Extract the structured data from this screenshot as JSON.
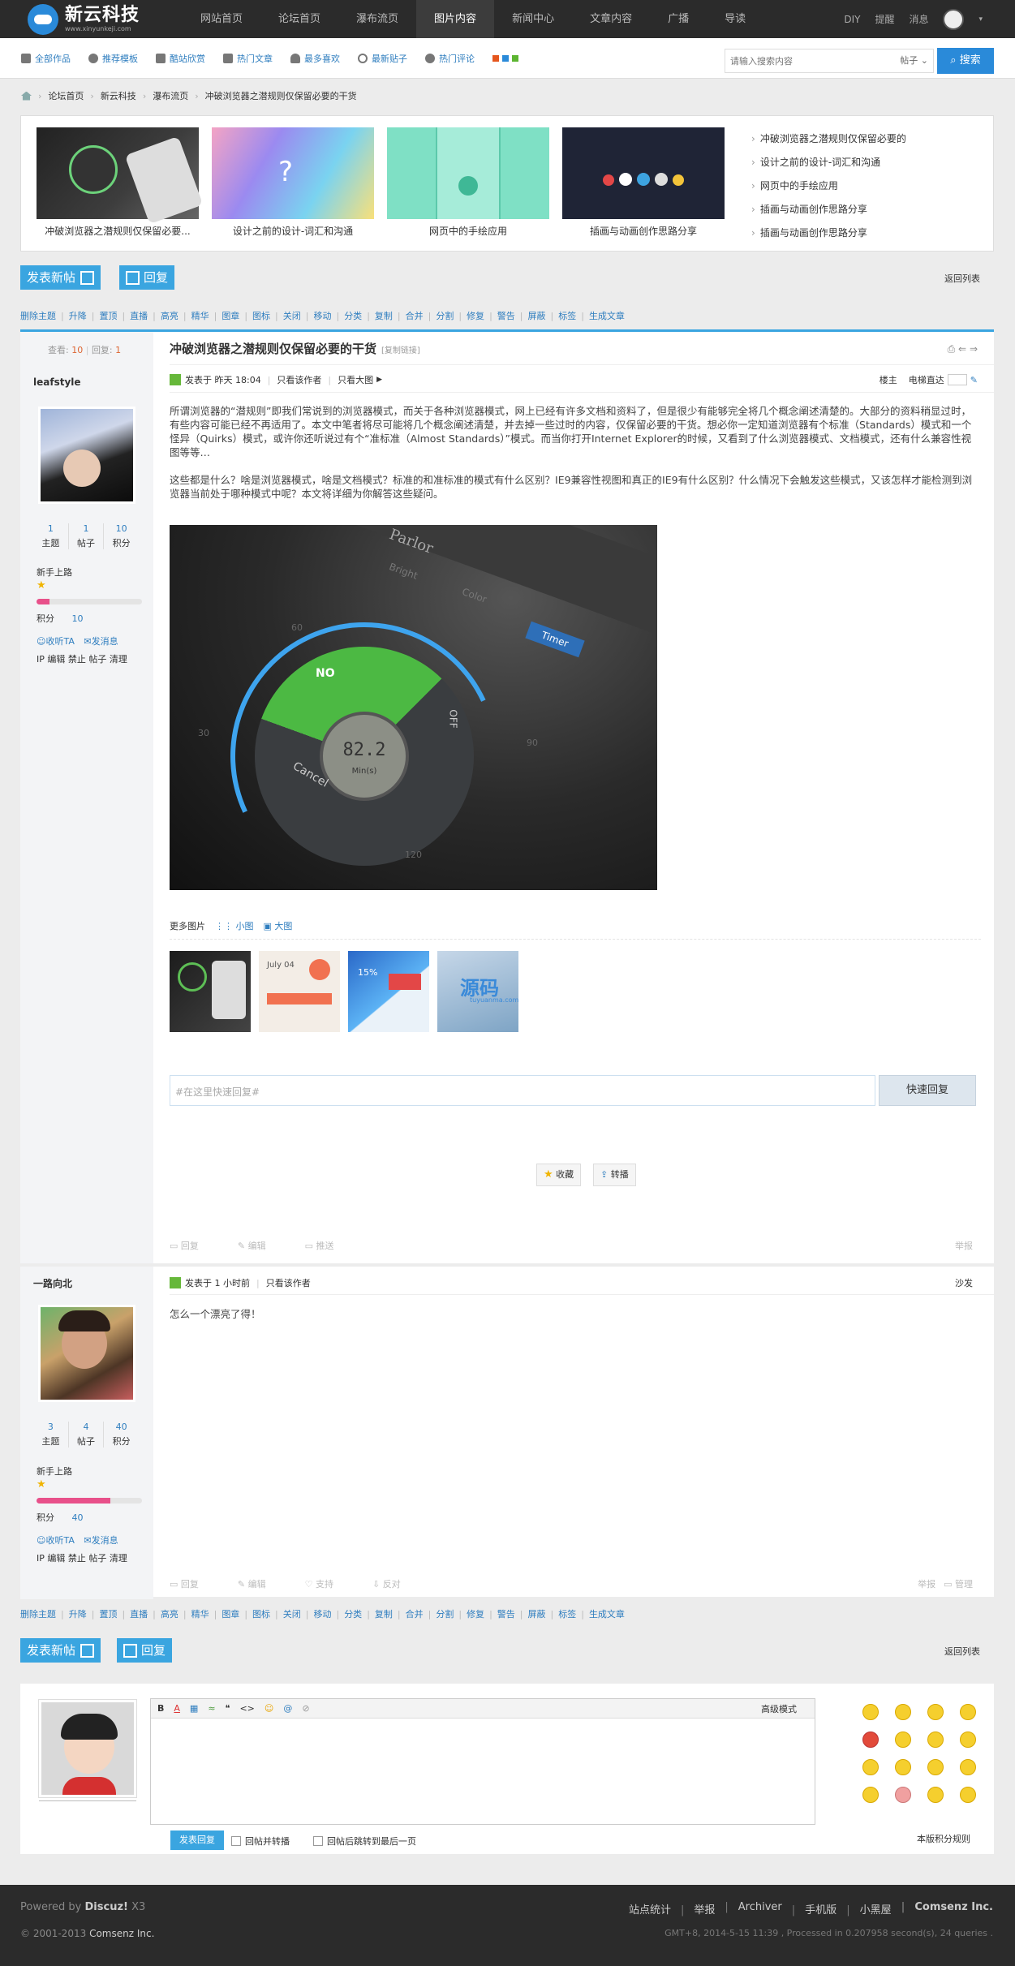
{
  "site": {
    "name": "新云科技",
    "domain": "www.xinyunkeji.com"
  },
  "nav": {
    "items": [
      "网站首页",
      "论坛首页",
      "瀑布流页",
      "图片内容",
      "新闻中心",
      "文章内容",
      "广播",
      "导读"
    ],
    "current": 3
  },
  "topright": {
    "items": [
      "DIY",
      "提醒",
      "消息"
    ]
  },
  "subbar": {
    "items": [
      "全部作品",
      "推荐模板",
      "酷站欣赏",
      "热门文章",
      "最多喜欢",
      "最新贴子",
      "热门评论"
    ],
    "colors": [
      "#e5561e",
      "#2a8ad9",
      "#5cb531"
    ]
  },
  "search": {
    "placeholder": "请输入搜索内容",
    "scope": "帖子",
    "button": "搜索"
  },
  "breadcrumb": [
    "论坛首页",
    "新云科技",
    "瀑布流页",
    "冲破浏览器之潜规则仅保留必要的干货"
  ],
  "slider": {
    "captions": [
      "冲破浏览器之潜规则仅保留必要...",
      "设计之前的设计-词汇和沟通",
      "网页中的手绘应用",
      "插画与动画创作思路分享"
    ],
    "hot": [
      "冲破浏览器之潜规则仅保留必要的",
      "设计之前的设计-词汇和沟通",
      "网页中的手绘应用",
      "插画与动画创作思路分享",
      "插画与动画创作思路分享"
    ]
  },
  "actions": {
    "newpost": "发表新帖",
    "reply": "回复",
    "backlist": "返回列表"
  },
  "modbar": [
    "删除主题",
    "升降",
    "置顶",
    "直播",
    "高亮",
    "精华",
    "图章",
    "图标",
    "关闭",
    "移动",
    "分类",
    "复制",
    "合并",
    "分割",
    "修复",
    "警告",
    "屏蔽",
    "标签",
    "生成文章"
  ],
  "thread": {
    "view_label": "查看:",
    "views": "10",
    "reply_label": "回复:",
    "replies": "1",
    "title": "冲破浏览器之潜规则仅保留必要的干货",
    "copylink": "[复制链接]"
  },
  "post1": {
    "user": "leafstyle",
    "stats": [
      {
        "n": "1",
        "l": "主题"
      },
      {
        "n": "1",
        "l": "帖子"
      },
      {
        "n": "10",
        "l": "积分"
      }
    ],
    "level": "新手上路",
    "progress": 0.12,
    "score_label": "积分",
    "score": "10",
    "links": [
      "收听TA",
      "发消息"
    ],
    "admin": "IP 编辑 禁止 帖子 清理",
    "meta": {
      "posted": "发表于 昨天 18:04",
      "author_only": "只看该作者",
      "big": "只看大图",
      "floor": "楼主",
      "jump": "电梯直达"
    },
    "para1": "所谓浏览器的“潜规则”即我们常说到的浏览器模式，而关于各种浏览器模式，网上已经有许多文档和资料了，但是很少有能够完全将几个概念阐述清楚的。大部分的资料稍显过时，有些内容可能已经不再适用了。本文中笔者将尽可能将几个概念阐述清楚，并去掉一些过时的内容，仅保留必要的干货。想必你一定知道浏览器有个标准（Standards）模式和一个怪异（Quirks）模式，或许你还听说过有个“准标准（Almost Standards）”模式。而当你打开Internet Explorer的时候，又看到了什么浏览器模式、文档模式，还有什么兼容性视图等等…",
    "para2": "这些都是什么？啥是浏览器模式，啥是文档模式？标准的和准标准的模式有什么区别？IE9兼容性视图和真正的IE9有什么区别？什么情况下会触发这些模式，又该怎样才能检测到浏览器当前处于哪种模式中呢？本文将详细为你解答这些疑问。",
    "main_img": {
      "no": "NO",
      "off": "OFF",
      "cancel": "Cancel",
      "timer": "Timer",
      "color": "Color",
      "bright": "Bright",
      "pianoh": "Parlor",
      "reading": "82.2",
      "unit": "Min(s)",
      "t90": "90",
      "t30": "30",
      "t120": "120",
      "t60": "60"
    },
    "more": {
      "label": "更多图片",
      "small": "小图",
      "big": "大图"
    },
    "thumbs": [
      "July 04",
      "15%",
      "源码",
      "tuyuanma.com"
    ],
    "quick_placeholder": "#在这里快速回复#",
    "quick_btn": "快速回复",
    "fav": "收藏",
    "share": "转播",
    "gray": [
      "回复",
      "编辑",
      "推送"
    ],
    "report": "举报"
  },
  "post2": {
    "user": "一路向北",
    "stats": [
      {
        "n": "3",
        "l": "主题"
      },
      {
        "n": "4",
        "l": "帖子"
      },
      {
        "n": "40",
        "l": "积分"
      }
    ],
    "level": "新手上路",
    "progress": 0.7,
    "score_label": "积分",
    "score": "40",
    "links": [
      "收听TA",
      "发消息"
    ],
    "admin": "IP 编辑 禁止 帖子 清理",
    "meta": {
      "posted": "发表于 1 小时前",
      "author_only": "只看该作者",
      "floor": "沙发"
    },
    "text": "怎么一个漂亮了得！",
    "gray": [
      "回复",
      "编辑",
      "支持",
      "反对"
    ],
    "report": "举报",
    "manage": "管理"
  },
  "editor": {
    "tools": [
      "B",
      "A",
      "▦",
      "≈",
      "❝",
      "<>",
      "☺",
      "@",
      "⊘"
    ],
    "advanced": "高级模式",
    "publish": "发表回复",
    "opt1": "回帖并转播",
    "opt2": "回帖后跳转到最后一页",
    "rules": "本版积分规则"
  },
  "footer": {
    "powered": "Powered by",
    "brand": "Discuz!",
    "ver": "X3",
    "copyright": "© 2001-2013",
    "company": "Comsenz Inc.",
    "links": [
      "站点统计",
      "举报",
      "Archiver",
      "手机版",
      "小黑屋",
      "Comsenz Inc."
    ],
    "info": "GMT+8, 2014-5-15 11:39 , Processed in 0.207958 second(s), 24 queries ."
  }
}
